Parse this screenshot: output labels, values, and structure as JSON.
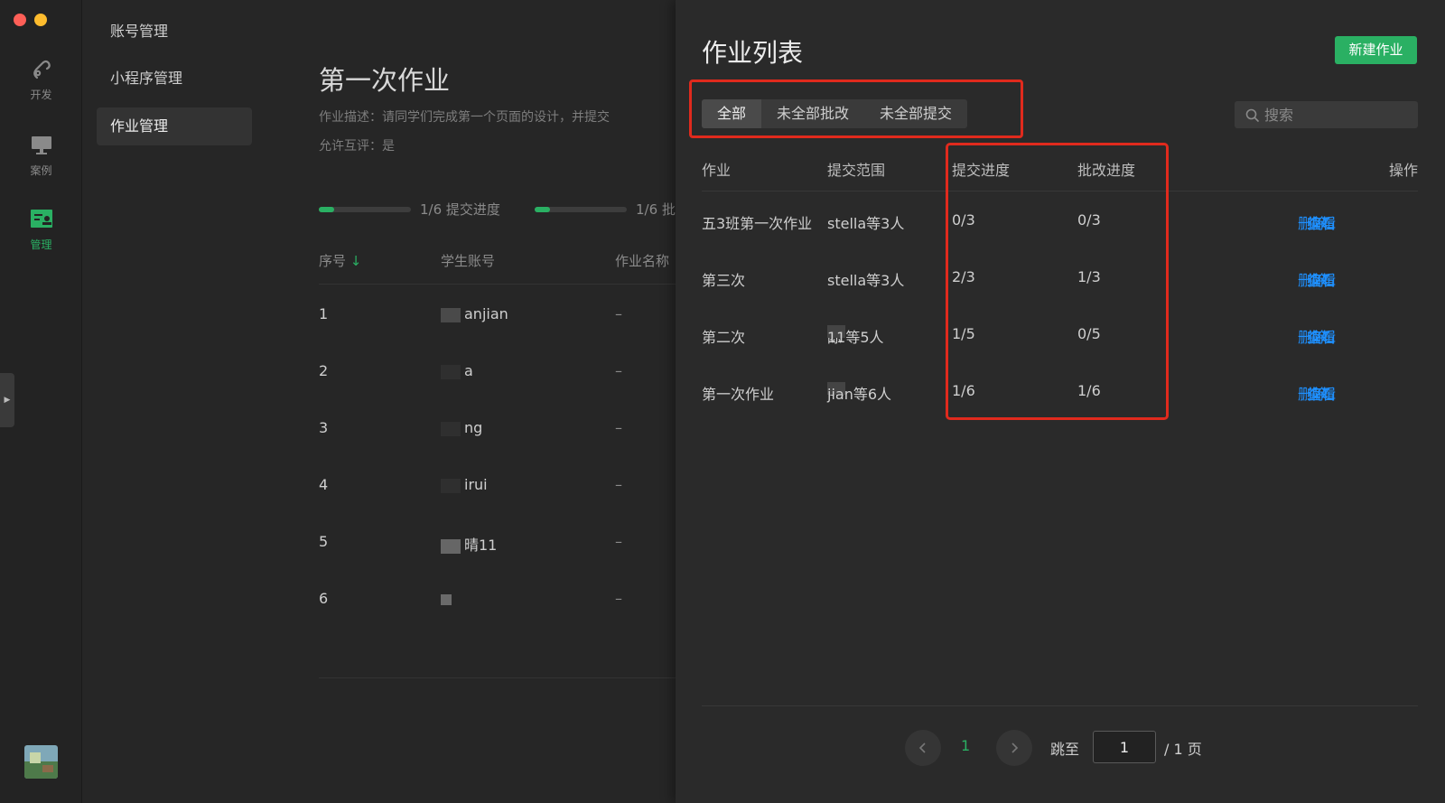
{
  "rail": {
    "items": [
      {
        "label": "开发",
        "icon": "dev-icon"
      },
      {
        "label": "案例",
        "icon": "case-icon"
      },
      {
        "label": "管理",
        "icon": "manage-icon",
        "active": true
      }
    ]
  },
  "menu": {
    "items": [
      {
        "label": "账号管理"
      },
      {
        "label": "小程序管理"
      },
      {
        "label": "作业管理",
        "active": true
      }
    ]
  },
  "detail": {
    "title": "第一次作业",
    "description": "作业描述：请同学们完成第一个页面的设计，并提交",
    "allow_review": "允许互评：是",
    "submit_progress_label": "1/6 提交进度",
    "submit_progress": 0.1667,
    "review_progress_label": "1/6 批",
    "review_progress": 0.1667,
    "columns": {
      "no": "序号",
      "sort_arrow": "↓",
      "account": "学生账号",
      "name": "作业名称"
    },
    "rows": [
      {
        "no": "1",
        "account": "anjian",
        "name": "–"
      },
      {
        "no": "2",
        "account": "a",
        "name": "–"
      },
      {
        "no": "3",
        "account": "ng",
        "name": "–"
      },
      {
        "no": "4",
        "account": "irui",
        "name": "–"
      },
      {
        "no": "5",
        "account": "晴11",
        "name": "–"
      },
      {
        "no": "6",
        "account": "",
        "name": "–"
      }
    ]
  },
  "panel": {
    "title": "作业列表",
    "new_button": "新建作业",
    "tabs": [
      {
        "label": "全部",
        "active": true
      },
      {
        "label": "未全部批改"
      },
      {
        "label": "未全部提交"
      }
    ],
    "search_placeholder": "搜索",
    "columns": {
      "assignment": "作业",
      "scope": "提交范围",
      "submit": "提交进度",
      "grade": "批改进度",
      "ops": "操作"
    },
    "rows": [
      {
        "assignment": "五3班第一次作业",
        "scope": "stella等3人",
        "submit": "0/3",
        "grade": "0/3"
      },
      {
        "assignment": "第三次",
        "scope": "stella等3人",
        "submit": "2/3",
        "grade": "1/3"
      },
      {
        "assignment": "第二次",
        "scope_prefix": "陈",
        "scope": "11等5人",
        "submit": "1/5",
        "grade": "0/5"
      },
      {
        "assignment": "第一次作业",
        "scope_prefix": "ch",
        "scope": "jian等6人",
        "submit": "1/6",
        "grade": "1/6"
      }
    ],
    "ops": {
      "delete": "删除",
      "edit": "编辑",
      "view": "查看"
    },
    "pagination": {
      "current": "1",
      "jump_label": "跳至",
      "jump_value": "1",
      "total": "/ 1 页"
    }
  },
  "colors": {
    "accent": "#2ab063",
    "link": "#1e90ff",
    "highlight": "#e02a1d"
  }
}
